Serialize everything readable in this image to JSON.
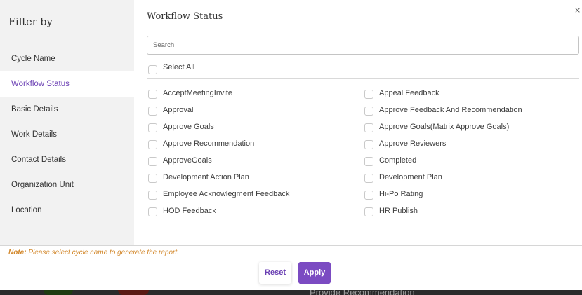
{
  "sidebar": {
    "title": "Filter by",
    "items": [
      {
        "label": "Cycle Name"
      },
      {
        "label": "Workflow Status"
      },
      {
        "label": "Basic Details"
      },
      {
        "label": "Work Details"
      },
      {
        "label": "Contact Details"
      },
      {
        "label": "Organization Unit"
      },
      {
        "label": "Location"
      }
    ],
    "active_item": "Workflow Status"
  },
  "panel": {
    "title": "Workflow Status",
    "close_glyph": "×",
    "search": {
      "placeholder": "Search",
      "value": ""
    },
    "select_all": {
      "label": "Select All",
      "checked": false
    },
    "options_left": [
      {
        "label": "AcceptMeetingInvite",
        "checked": false
      },
      {
        "label": "Approval",
        "checked": false
      },
      {
        "label": "Approve Goals",
        "checked": false
      },
      {
        "label": "Approve Recommendation",
        "checked": false
      },
      {
        "label": "ApproveGoals",
        "checked": false
      },
      {
        "label": "Development Action Plan",
        "checked": false
      },
      {
        "label": "Employee Acknowlegment Feedback",
        "checked": false
      },
      {
        "label": "HOD Feedback",
        "checked": false
      }
    ],
    "options_right": [
      {
        "label": "Appeal Feedback",
        "checked": false
      },
      {
        "label": "Approve Feedback And Recommendation",
        "checked": false
      },
      {
        "label": "Approve Goals(Matrix Approve Goals)",
        "checked": false
      },
      {
        "label": "Approve Reviewers",
        "checked": false
      },
      {
        "label": "Completed",
        "checked": false
      },
      {
        "label": "Development Plan",
        "checked": false
      },
      {
        "label": "Hi-Po Rating",
        "checked": false
      },
      {
        "label": "HR Publish",
        "checked": false
      }
    ]
  },
  "footer": {
    "note_label": "Note:",
    "note_text": " Please select cycle name to generate the report.",
    "reset_label": "Reset",
    "apply_label": "Apply"
  },
  "background": {
    "peek_text": "Provide Recommendation"
  },
  "colors": {
    "accent": "#7b4bc2",
    "active_text": "#6a3fb3",
    "note": "#d2872a",
    "sidebar_bg": "#f2f2f2"
  }
}
